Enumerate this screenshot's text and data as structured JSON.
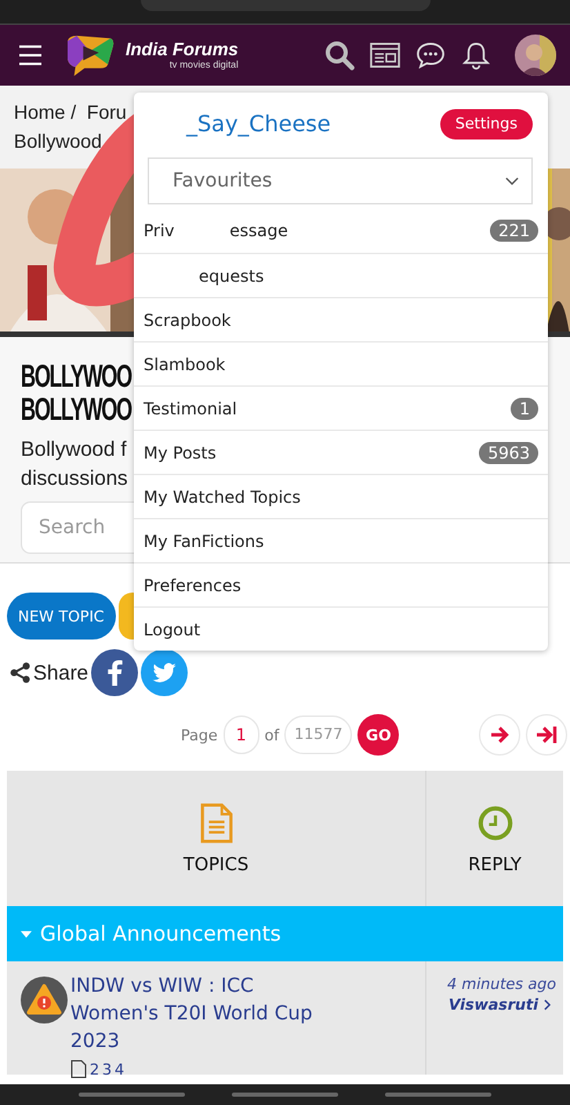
{
  "header": {
    "brand": "India Forums",
    "tagline": "tv movies digital"
  },
  "breadcrumb": {
    "line_1": "Home /  Foru",
    "line_2": "Bollywood"
  },
  "forum": {
    "title_lines": [
      "BOLLYWOO",
      "BOLLYWOO"
    ],
    "description_lines": [
      "Bollywood f",
      "discussions"
    ],
    "search": {
      "placeholder": "Search"
    }
  },
  "actions": {
    "new_topic": "NEW TOPIC"
  },
  "share": {
    "label": "Share"
  },
  "pagination": {
    "label": "Page",
    "page": "1",
    "of": "of",
    "total": "11577",
    "go": "GO"
  },
  "table": {
    "columns": [
      "TOPICS",
      "REPLY"
    ],
    "sections": [
      {
        "title": "Global Announcements",
        "expanded": true,
        "topics": [
          {
            "title": "INDW vs WIW : ICC Women's T20I World Cup 2023",
            "pages": [
              "2",
              "3",
              "4"
            ],
            "time": "4 minutes ago",
            "author": "Viswasruti"
          }
        ]
      }
    ]
  },
  "user_menu": {
    "username": "_Say_Cheese",
    "settings": "Settings",
    "favourites": {
      "value": "Favourites"
    },
    "items": [
      {
        "kind": "split",
        "label_parts": [
          "Priv",
          "essage"
        ],
        "badge": "221"
      },
      {
        "kind": "tail",
        "label_parts": [
          "equests"
        ]
      },
      {
        "kind": "plain",
        "label_parts": [
          "Scrapbook"
        ]
      },
      {
        "kind": "plain",
        "label_parts": [
          "Slambook"
        ]
      },
      {
        "kind": "plain",
        "label_parts": [
          "Testimonial"
        ],
        "badge": "1"
      },
      {
        "kind": "plain",
        "label_parts": [
          "My Posts"
        ],
        "badge": "5963"
      },
      {
        "kind": "plain",
        "label_parts": [
          "My Watched Topics"
        ]
      },
      {
        "kind": "plain",
        "label_parts": [
          "My FanFictions"
        ]
      },
      {
        "kind": "plain",
        "label_parts": [
          "Preferences"
        ]
      },
      {
        "kind": "plain",
        "label_parts": [
          "Logout"
        ]
      }
    ]
  }
}
